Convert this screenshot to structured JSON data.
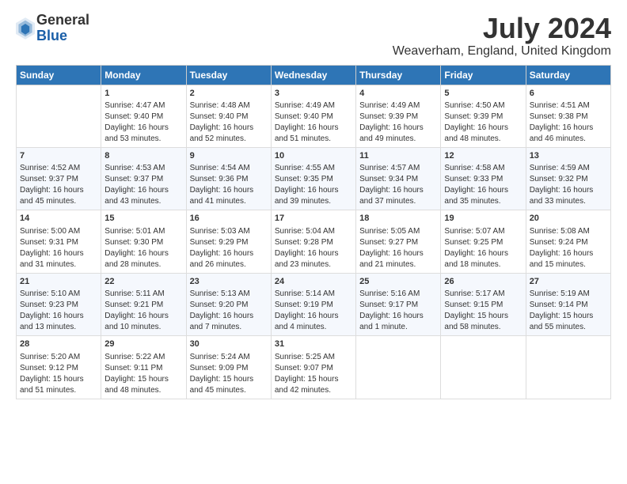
{
  "logo": {
    "general": "General",
    "blue": "Blue"
  },
  "title": "July 2024",
  "subtitle": "Weaverham, England, United Kingdom",
  "days_header": [
    "Sunday",
    "Monday",
    "Tuesday",
    "Wednesday",
    "Thursday",
    "Friday",
    "Saturday"
  ],
  "weeks": [
    [
      {
        "day": "",
        "lines": []
      },
      {
        "day": "1",
        "lines": [
          "Sunrise: 4:47 AM",
          "Sunset: 9:40 PM",
          "Daylight: 16 hours",
          "and 53 minutes."
        ]
      },
      {
        "day": "2",
        "lines": [
          "Sunrise: 4:48 AM",
          "Sunset: 9:40 PM",
          "Daylight: 16 hours",
          "and 52 minutes."
        ]
      },
      {
        "day": "3",
        "lines": [
          "Sunrise: 4:49 AM",
          "Sunset: 9:40 PM",
          "Daylight: 16 hours",
          "and 51 minutes."
        ]
      },
      {
        "day": "4",
        "lines": [
          "Sunrise: 4:49 AM",
          "Sunset: 9:39 PM",
          "Daylight: 16 hours",
          "and 49 minutes."
        ]
      },
      {
        "day": "5",
        "lines": [
          "Sunrise: 4:50 AM",
          "Sunset: 9:39 PM",
          "Daylight: 16 hours",
          "and 48 minutes."
        ]
      },
      {
        "day": "6",
        "lines": [
          "Sunrise: 4:51 AM",
          "Sunset: 9:38 PM",
          "Daylight: 16 hours",
          "and 46 minutes."
        ]
      }
    ],
    [
      {
        "day": "7",
        "lines": [
          "Sunrise: 4:52 AM",
          "Sunset: 9:37 PM",
          "Daylight: 16 hours",
          "and 45 minutes."
        ]
      },
      {
        "day": "8",
        "lines": [
          "Sunrise: 4:53 AM",
          "Sunset: 9:37 PM",
          "Daylight: 16 hours",
          "and 43 minutes."
        ]
      },
      {
        "day": "9",
        "lines": [
          "Sunrise: 4:54 AM",
          "Sunset: 9:36 PM",
          "Daylight: 16 hours",
          "and 41 minutes."
        ]
      },
      {
        "day": "10",
        "lines": [
          "Sunrise: 4:55 AM",
          "Sunset: 9:35 PM",
          "Daylight: 16 hours",
          "and 39 minutes."
        ]
      },
      {
        "day": "11",
        "lines": [
          "Sunrise: 4:57 AM",
          "Sunset: 9:34 PM",
          "Daylight: 16 hours",
          "and 37 minutes."
        ]
      },
      {
        "day": "12",
        "lines": [
          "Sunrise: 4:58 AM",
          "Sunset: 9:33 PM",
          "Daylight: 16 hours",
          "and 35 minutes."
        ]
      },
      {
        "day": "13",
        "lines": [
          "Sunrise: 4:59 AM",
          "Sunset: 9:32 PM",
          "Daylight: 16 hours",
          "and 33 minutes."
        ]
      }
    ],
    [
      {
        "day": "14",
        "lines": [
          "Sunrise: 5:00 AM",
          "Sunset: 9:31 PM",
          "Daylight: 16 hours",
          "and 31 minutes."
        ]
      },
      {
        "day": "15",
        "lines": [
          "Sunrise: 5:01 AM",
          "Sunset: 9:30 PM",
          "Daylight: 16 hours",
          "and 28 minutes."
        ]
      },
      {
        "day": "16",
        "lines": [
          "Sunrise: 5:03 AM",
          "Sunset: 9:29 PM",
          "Daylight: 16 hours",
          "and 26 minutes."
        ]
      },
      {
        "day": "17",
        "lines": [
          "Sunrise: 5:04 AM",
          "Sunset: 9:28 PM",
          "Daylight: 16 hours",
          "and 23 minutes."
        ]
      },
      {
        "day": "18",
        "lines": [
          "Sunrise: 5:05 AM",
          "Sunset: 9:27 PM",
          "Daylight: 16 hours",
          "and 21 minutes."
        ]
      },
      {
        "day": "19",
        "lines": [
          "Sunrise: 5:07 AM",
          "Sunset: 9:25 PM",
          "Daylight: 16 hours",
          "and 18 minutes."
        ]
      },
      {
        "day": "20",
        "lines": [
          "Sunrise: 5:08 AM",
          "Sunset: 9:24 PM",
          "Daylight: 16 hours",
          "and 15 minutes."
        ]
      }
    ],
    [
      {
        "day": "21",
        "lines": [
          "Sunrise: 5:10 AM",
          "Sunset: 9:23 PM",
          "Daylight: 16 hours",
          "and 13 minutes."
        ]
      },
      {
        "day": "22",
        "lines": [
          "Sunrise: 5:11 AM",
          "Sunset: 9:21 PM",
          "Daylight: 16 hours",
          "and 10 minutes."
        ]
      },
      {
        "day": "23",
        "lines": [
          "Sunrise: 5:13 AM",
          "Sunset: 9:20 PM",
          "Daylight: 16 hours",
          "and 7 minutes."
        ]
      },
      {
        "day": "24",
        "lines": [
          "Sunrise: 5:14 AM",
          "Sunset: 9:19 PM",
          "Daylight: 16 hours",
          "and 4 minutes."
        ]
      },
      {
        "day": "25",
        "lines": [
          "Sunrise: 5:16 AM",
          "Sunset: 9:17 PM",
          "Daylight: 16 hours",
          "and 1 minute."
        ]
      },
      {
        "day": "26",
        "lines": [
          "Sunrise: 5:17 AM",
          "Sunset: 9:15 PM",
          "Daylight: 15 hours",
          "and 58 minutes."
        ]
      },
      {
        "day": "27",
        "lines": [
          "Sunrise: 5:19 AM",
          "Sunset: 9:14 PM",
          "Daylight: 15 hours",
          "and 55 minutes."
        ]
      }
    ],
    [
      {
        "day": "28",
        "lines": [
          "Sunrise: 5:20 AM",
          "Sunset: 9:12 PM",
          "Daylight: 15 hours",
          "and 51 minutes."
        ]
      },
      {
        "day": "29",
        "lines": [
          "Sunrise: 5:22 AM",
          "Sunset: 9:11 PM",
          "Daylight: 15 hours",
          "and 48 minutes."
        ]
      },
      {
        "day": "30",
        "lines": [
          "Sunrise: 5:24 AM",
          "Sunset: 9:09 PM",
          "Daylight: 15 hours",
          "and 45 minutes."
        ]
      },
      {
        "day": "31",
        "lines": [
          "Sunrise: 5:25 AM",
          "Sunset: 9:07 PM",
          "Daylight: 15 hours",
          "and 42 minutes."
        ]
      },
      {
        "day": "",
        "lines": []
      },
      {
        "day": "",
        "lines": []
      },
      {
        "day": "",
        "lines": []
      }
    ]
  ]
}
